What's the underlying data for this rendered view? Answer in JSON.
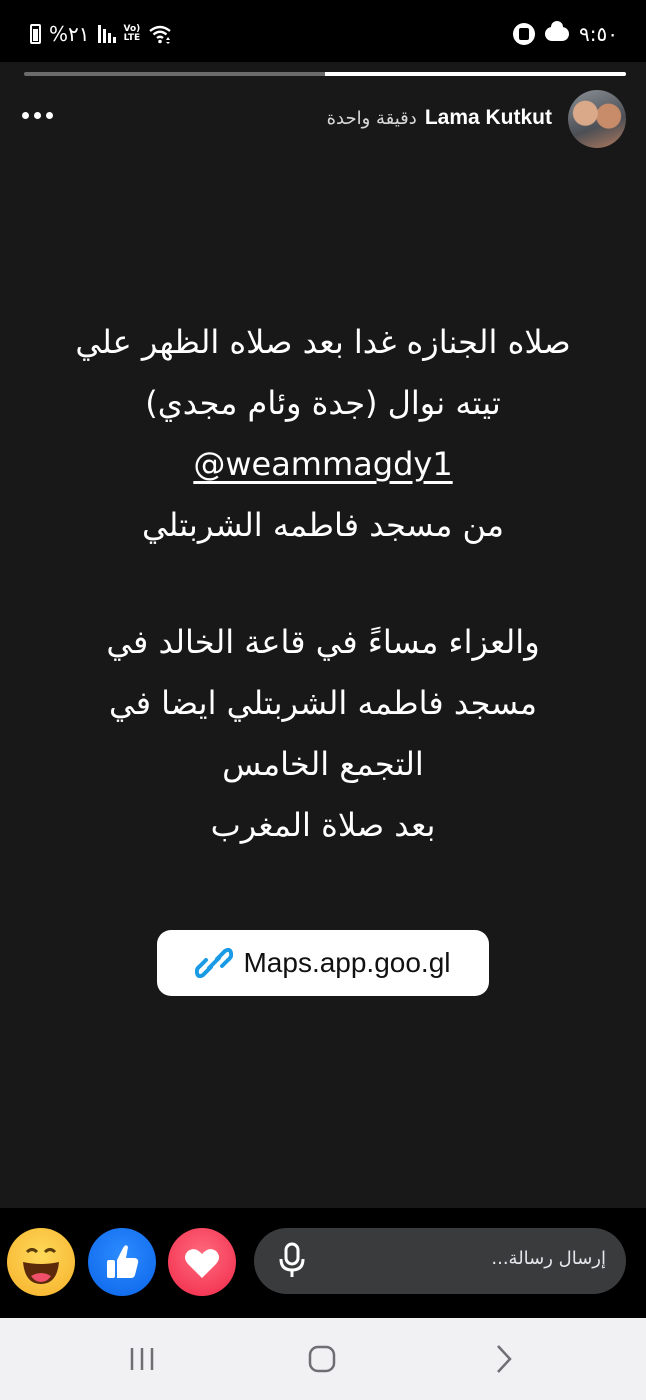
{
  "status_bar": {
    "battery_percent": "%٢١",
    "network": "Vo) LTE",
    "time": "٩:٥٠"
  },
  "story": {
    "progress": 0.5,
    "author": "Lama Kutkut",
    "time_ago": "دقيقة واحدة",
    "lines": [
      "صلاه الجنازه غدا بعد صلاه الظهر علي",
      "تيته نوال (جدة وئام مجدي)",
      "@weammagdy1",
      "من مسجد فاطمه الشربتلي",
      "والعزاء مساءً في قاعة الخالد في",
      "مسجد فاطمه الشربتلي ايضا في",
      "التجمع الخامس",
      "بعد صلاة المغرب"
    ],
    "link_sticker": "Maps.app.goo.gl"
  },
  "reply_bar": {
    "placeholder": "إرسال رسالة...",
    "reactions": [
      "haha-reaction",
      "like-reaction",
      "love-reaction"
    ]
  },
  "icons": {
    "link": "link-icon",
    "mic": "microphone-icon",
    "menu": "more-dots-icon"
  },
  "colors": {
    "story_bg": "#181818",
    "like": "#1877f2",
    "love": "#f02849",
    "link_blue": "#1a9be6"
  }
}
